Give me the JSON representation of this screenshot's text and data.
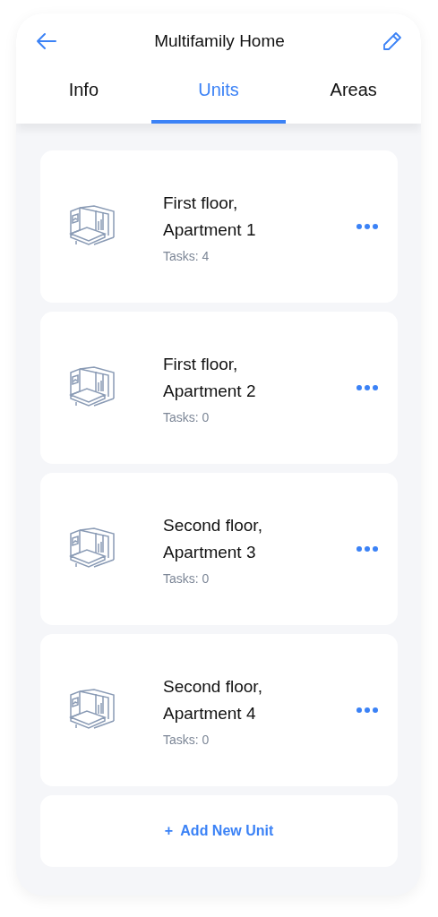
{
  "header": {
    "title": "Multifamily Home"
  },
  "tabs": [
    {
      "label": "Info",
      "selected": false
    },
    {
      "label": "Units",
      "selected": true
    },
    {
      "label": "Areas",
      "selected": false
    }
  ],
  "units": [
    {
      "name": "First floor,\nApartment 1",
      "tasks": "Tasks: 4"
    },
    {
      "name": "First floor,\nApartment 2",
      "tasks": "Tasks: 0"
    },
    {
      "name": "Second floor,\nApartment 3",
      "tasks": "Tasks: 0"
    },
    {
      "name": "Second floor,\nApartment 4",
      "tasks": "Tasks: 0"
    }
  ],
  "add_button": {
    "label": "+  Add New Unit"
  }
}
